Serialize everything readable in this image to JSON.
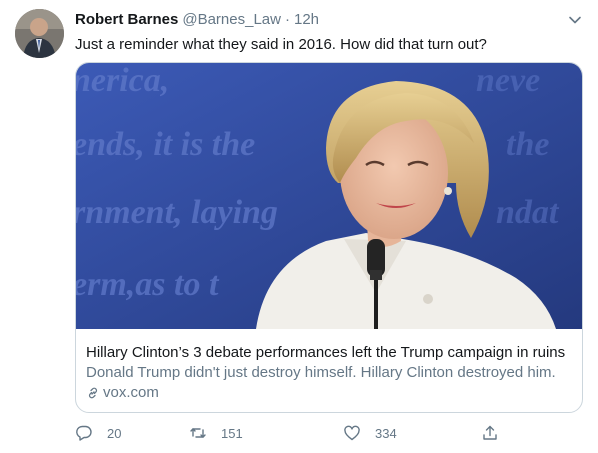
{
  "tweet": {
    "author_name": "Robert Barnes",
    "author_handle": "@Barnes_Law",
    "separator": "·",
    "time": "12h",
    "text": "Just a reminder what they said in 2016. How did that turn out?"
  },
  "card": {
    "title": "Hillary Clinton’s 3 debate performances left the Trump campaign in ruins",
    "description": "Donald Trump didn't just destroy himself. Hillary Clinton destroyed him.",
    "domain": "vox.com",
    "backdrop_text": [
      "nerica,",
      "ends, it is the",
      "rnment, laying",
      "erm,as to t"
    ]
  },
  "actions": {
    "replies": "20",
    "retweets": "151",
    "likes": "334"
  },
  "icons": {
    "caret": "chevron-down-icon",
    "reply": "reply-icon",
    "retweet": "retweet-icon",
    "like": "heart-icon",
    "share": "share-icon",
    "link": "link-icon"
  },
  "colors": {
    "text_primary": "#14171a",
    "text_secondary": "#657786",
    "border": "#ccd6dd",
    "backdrop_blue": "#3550a8"
  }
}
